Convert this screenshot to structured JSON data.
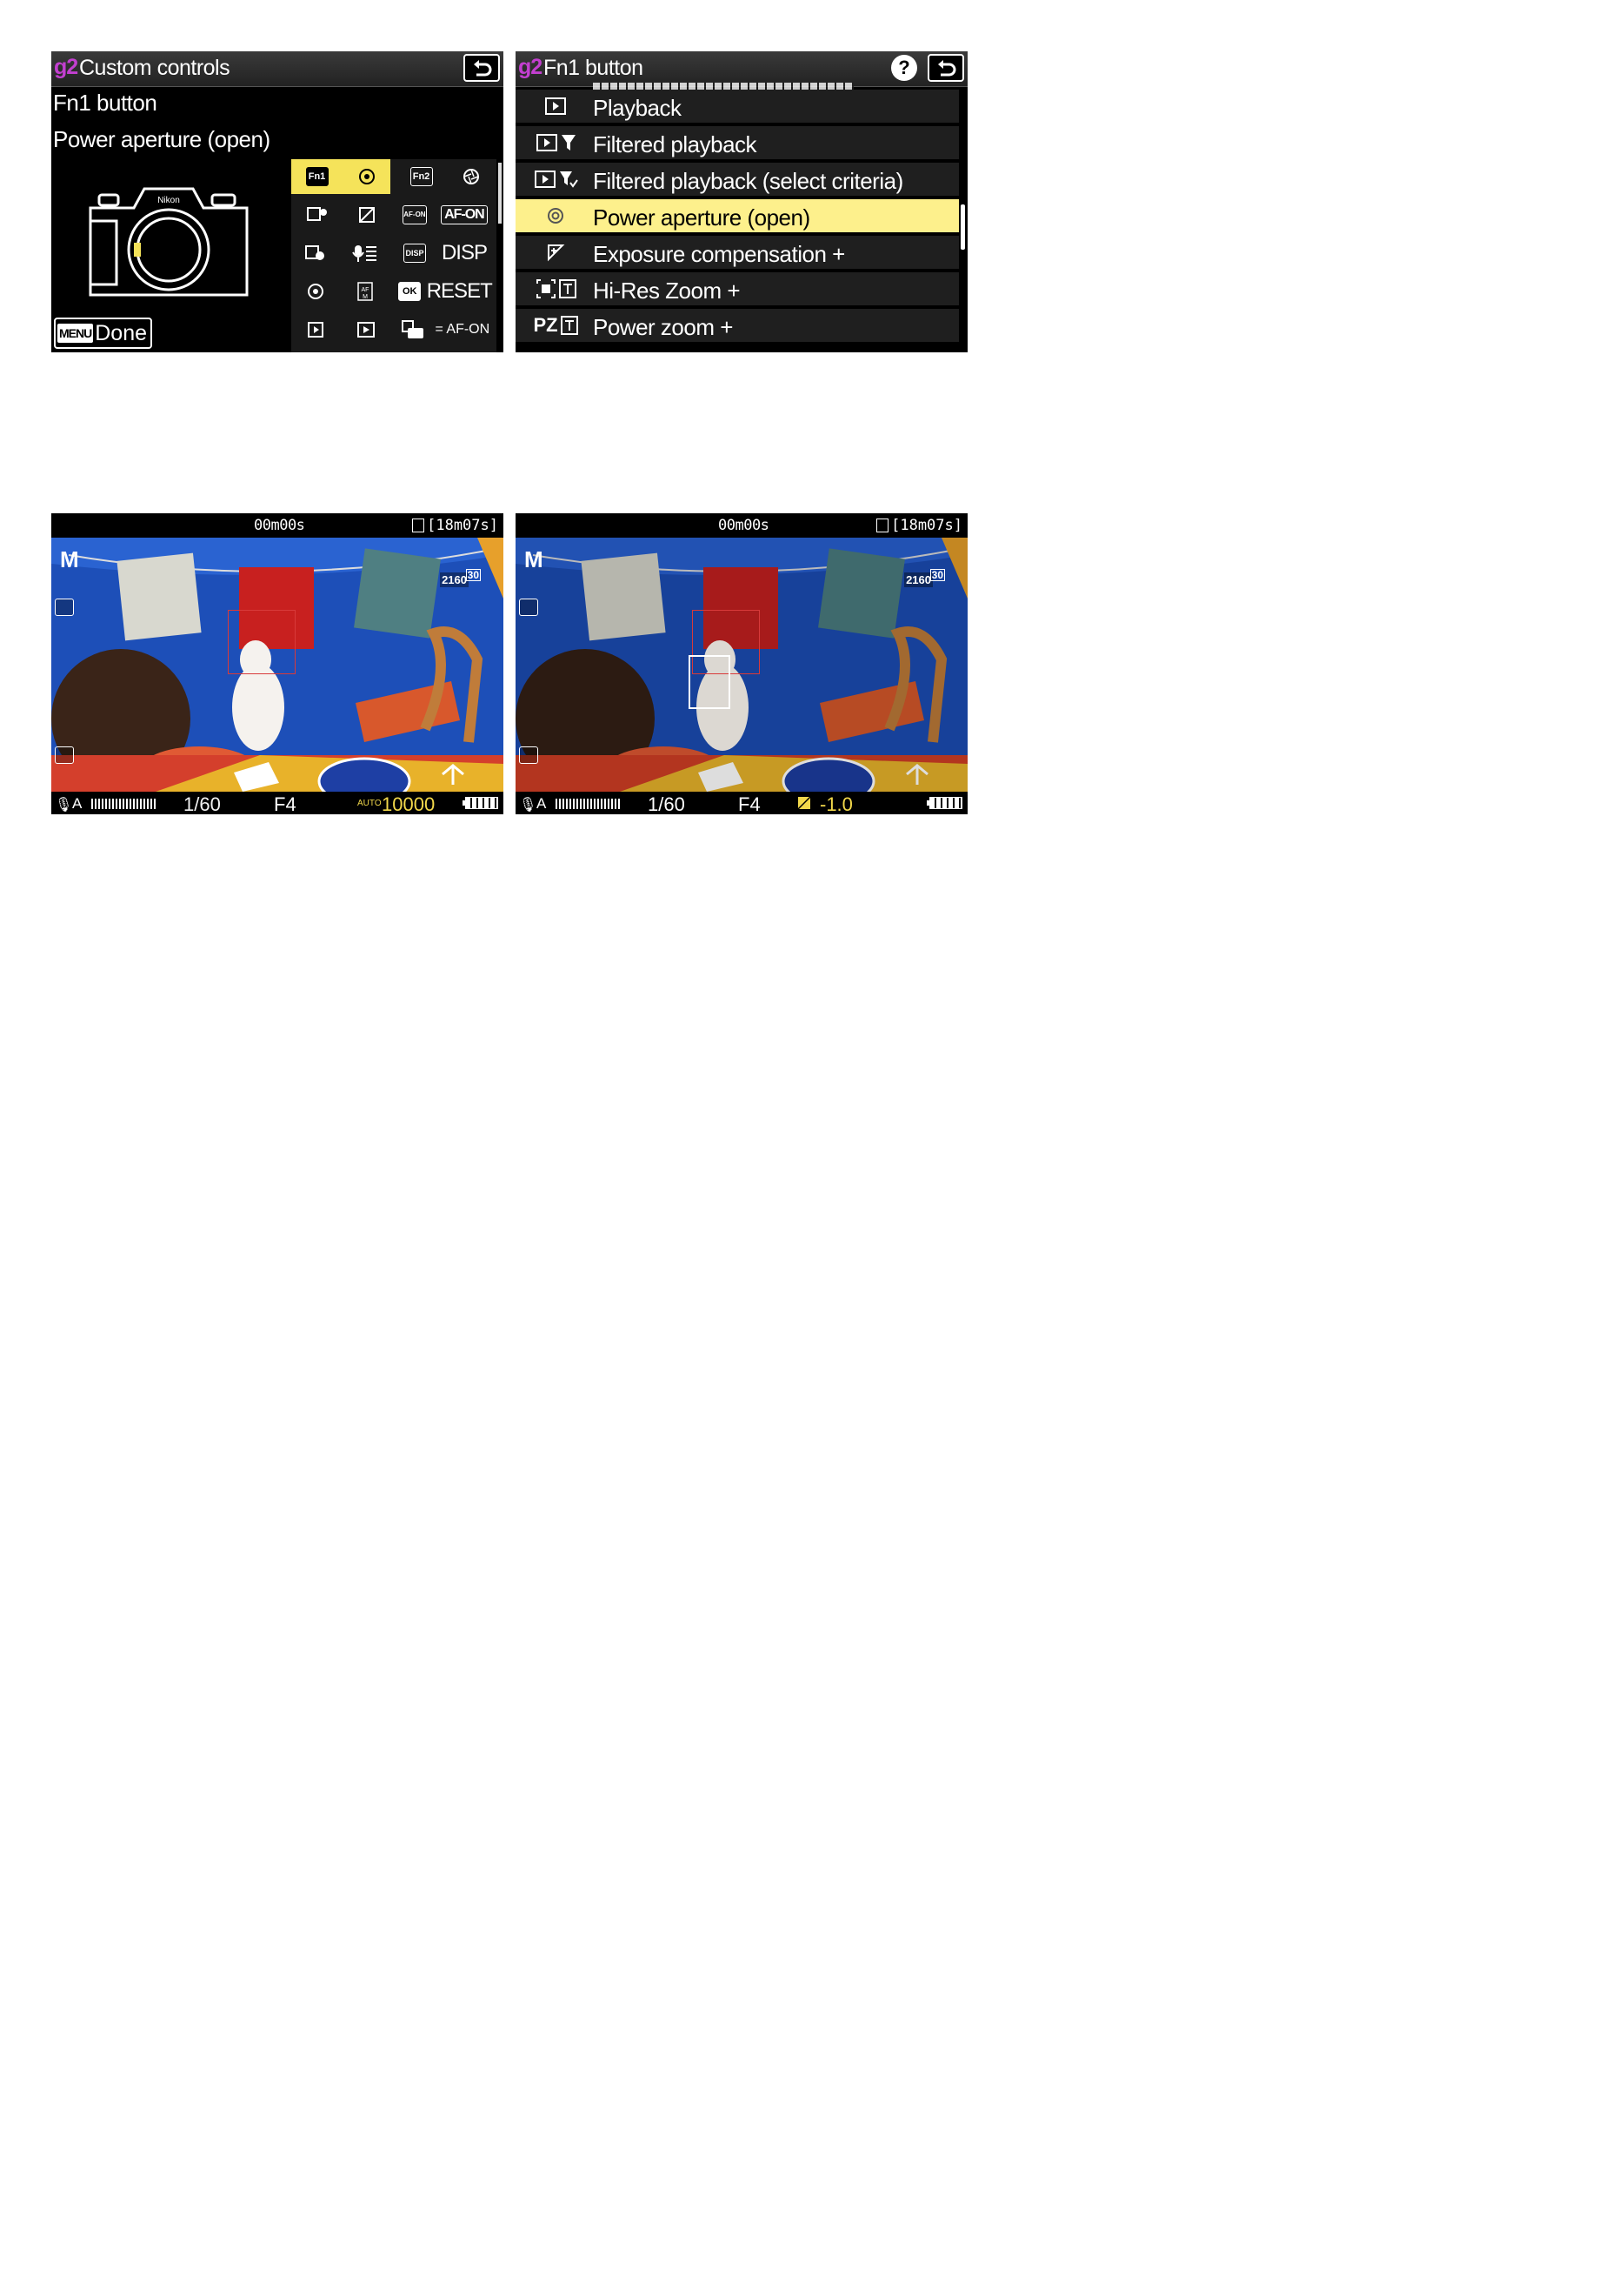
{
  "screen1": {
    "header": {
      "code": "g2",
      "title": "Custom controls"
    },
    "control_name": "Fn1 button",
    "assignment": "Power aperture (open)",
    "footer": {
      "menu_tag": "MENU",
      "done": "Done"
    },
    "grid": [
      {
        "left": "Fn1",
        "right": ""
      },
      {
        "left": "Fn2",
        "right": ""
      },
      {
        "left": "",
        "right": ""
      },
      {
        "left": "AF-ON",
        "right": "AF-ON"
      },
      {
        "left": "",
        "right": ""
      },
      {
        "left": "DISP",
        "right": "DISP"
      },
      {
        "left": "",
        "right": ""
      },
      {
        "left": "OK",
        "right": "RESET"
      },
      {
        "left": "",
        "right": ""
      },
      {
        "left": "",
        "right": "= AF-ON"
      }
    ]
  },
  "screen2": {
    "header": {
      "code": "g2",
      "title": "Fn1 button",
      "help": "?"
    },
    "items": [
      {
        "icon": "PLAY",
        "label": "Playback"
      },
      {
        "icon": "PLAY-FILTER",
        "label": "Filtered playback"
      },
      {
        "icon": "PLAY-FILTER-CHECK",
        "label": "Filtered playback (select criteria)"
      },
      {
        "icon": "APERTURE",
        "label": "Power aperture (open)"
      },
      {
        "icon": "EXPOSURE",
        "label": "Exposure compensation +"
      },
      {
        "icon": "HIRES",
        "label": "Hi-Res Zoom +"
      },
      {
        "icon": "PZ",
        "label": "Power zoom +"
      }
    ],
    "selected_index": 3,
    "pz_prefix": "PZ",
    "t_box": "T"
  },
  "live1": {
    "time": "00m00s",
    "remaining": "[18m07s]",
    "mode": "M",
    "resolution": "2160",
    "fps": "30",
    "focus": "A",
    "shutter": "1/60",
    "aperture": "F4",
    "iso_label": "AUTO",
    "iso_value": "10000"
  },
  "live2": {
    "time": "00m00s",
    "remaining": "[18m07s]",
    "mode": "M",
    "resolution": "2160",
    "fps": "30",
    "focus": "A",
    "shutter": "1/60",
    "aperture": "F4",
    "exposure_comp": "-1.0"
  },
  "colors": {
    "menu_code": "#c33fd0",
    "selection": "#fdf08c",
    "grid_selection": "#f5e35a",
    "iso_value": "#f2d84b",
    "exposure_value": "#f2d84b"
  }
}
